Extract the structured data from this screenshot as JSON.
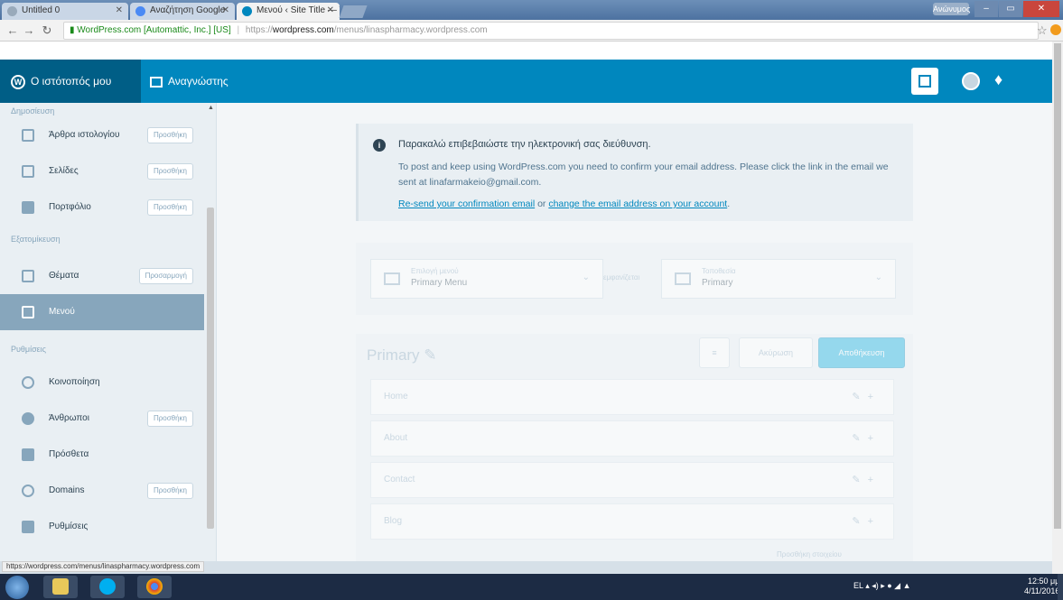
{
  "browser": {
    "tabs": [
      {
        "label": "Untitled 0"
      },
      {
        "label": "Αναζήτηση Google"
      },
      {
        "label": "Μενού ‹ Site Title — Wo"
      }
    ],
    "user_button": "Ανώνυμος",
    "address": {
      "secure_label": "WordPress.com [Automattic, Inc.] [US]",
      "url_prefix": "https://",
      "url_host": "wordpress.com",
      "url_path": "/menus/linaspharmacy.wordpress.com"
    },
    "status_url": "https://wordpress.com/menus/linaspharmacy.wordpress.com"
  },
  "masterbar": {
    "my_site": "Ο ιστότοπός μου",
    "reader": "Αναγνώστης"
  },
  "sidebar": {
    "section_publish": "Δημοσίευση",
    "section_personalize": "Εξατομίκευση",
    "section_configure": "Ρυθμίσεις",
    "items": [
      {
        "label": "Άρθρα ιστολογίου",
        "action": "Προσθήκη"
      },
      {
        "label": "Σελίδες",
        "action": "Προσθήκη"
      },
      {
        "label": "Πορτφόλιο",
        "action": "Προσθήκη"
      },
      {
        "label": "Θέματα",
        "action": "Προσαρμογή"
      },
      {
        "label": "Μενού",
        "action": ""
      },
      {
        "label": "Κοινοποίηση",
        "action": ""
      },
      {
        "label": "Άνθρωποι",
        "action": "Προσθήκη"
      },
      {
        "label": "Πρόσθετα",
        "action": ""
      },
      {
        "label": "Domains",
        "action": "Προσθήκη"
      },
      {
        "label": "Ρυθμίσεις",
        "action": ""
      }
    ]
  },
  "notice": {
    "title": "Παρακαλώ επιβεβαιώστε την ηλεκτρονική σας διεύθυνση.",
    "body": "To post and keep using WordPress.com you need to confirm your email address. Please click the link in the email we sent at linafarmakeio@gmail.com.",
    "resend_link": "Re-send your confirmation email",
    "or_text": " or ",
    "change_link": "change the email address on your account",
    "end_text": "."
  },
  "menu_selectors": {
    "left_label": "Επιλογή μενού",
    "left_value": "Primary Menu",
    "connector": "εμφανίζεται",
    "right_label": "Τοποθεσία",
    "right_value": "Primary"
  },
  "menu_editor": {
    "title": "Primary",
    "cancel_label": "Ακύρωση",
    "save_label": "Αποθήκευση",
    "items": [
      "Home",
      "About",
      "Contact",
      "Blog"
    ],
    "footer_link": "Προσθήκη στοιχείου"
  },
  "taskbar": {
    "tray_lang": "EL",
    "clock_time": "12:50 μμ",
    "clock_date": "4/11/2016"
  }
}
